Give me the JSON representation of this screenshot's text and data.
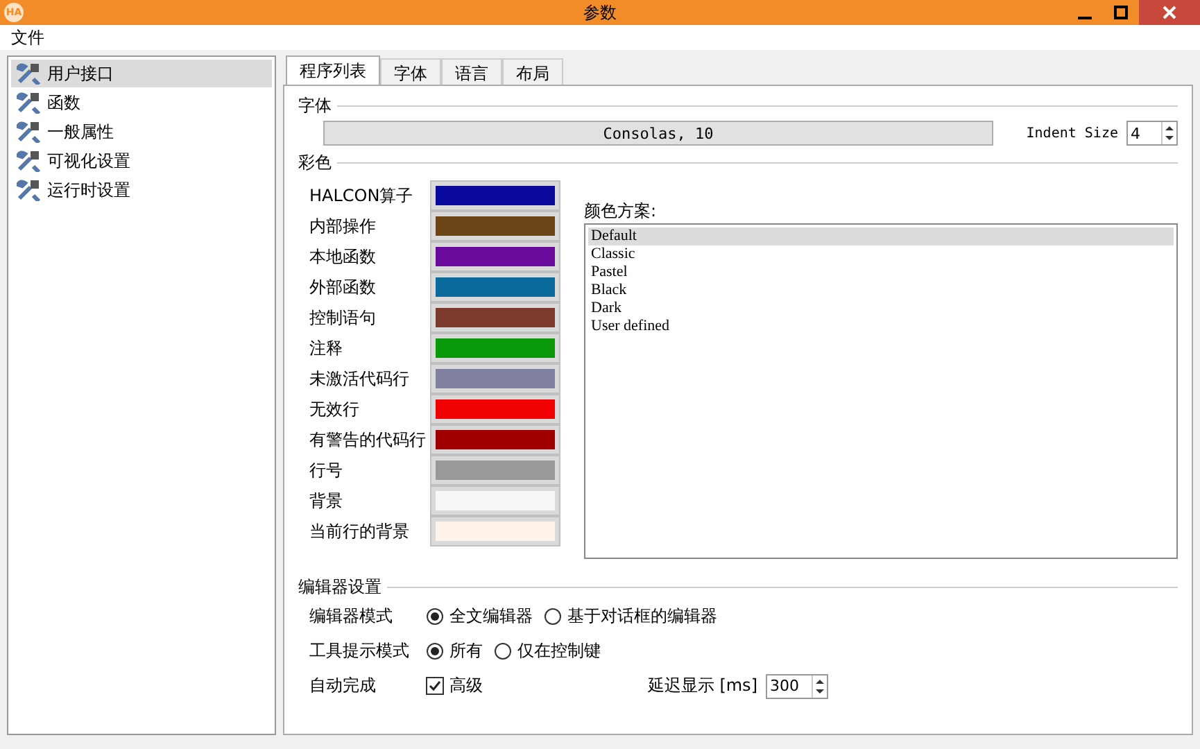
{
  "window": {
    "app_icon_text": "HA",
    "title": "参数"
  },
  "menu": [
    "文件"
  ],
  "sidebar": {
    "items": [
      {
        "label": "用户接口",
        "selected": true
      },
      {
        "label": "函数",
        "selected": false
      },
      {
        "label": "一般属性",
        "selected": false
      },
      {
        "label": "可视化设置",
        "selected": false
      },
      {
        "label": "运行时设置",
        "selected": false
      }
    ]
  },
  "tabs": [
    {
      "label": "程序列表",
      "selected": true
    },
    {
      "label": "字体",
      "selected": false
    },
    {
      "label": "语言",
      "selected": false
    },
    {
      "label": "布局",
      "selected": false
    }
  ],
  "font_section": {
    "heading": "字体",
    "font_button": "Consolas, 10",
    "indent_label": "Indent Size",
    "indent_value": "4"
  },
  "color_section": {
    "heading": "彩色",
    "colors": [
      {
        "label": "HALCON算子",
        "color": "#0a0a9c"
      },
      {
        "label": "内部操作",
        "color": "#6b4516"
      },
      {
        "label": "本地函数",
        "color": "#6a0a9c"
      },
      {
        "label": "外部函数",
        "color": "#0a6a9c"
      },
      {
        "label": "控制语句",
        "color": "#7b3a2a"
      },
      {
        "label": "注释",
        "color": "#0a990a"
      },
      {
        "label": "未激活代码行",
        "color": "#8080a0"
      },
      {
        "label": "无效行",
        "color": "#f00000"
      },
      {
        "label": "有警告的代码行",
        "color": "#a00000"
      },
      {
        "label": "行号",
        "color": "#999999"
      },
      {
        "label": "背景",
        "color": "#f8f8f8"
      },
      {
        "label": "当前行的背景",
        "color": "#fdf3ea"
      }
    ],
    "scheme_label": "颜色方案:",
    "schemes": [
      {
        "label": "Default",
        "selected": true
      },
      {
        "label": "Classic",
        "selected": false
      },
      {
        "label": "Pastel",
        "selected": false
      },
      {
        "label": "Black",
        "selected": false
      },
      {
        "label": "Dark",
        "selected": false
      },
      {
        "label": "User defined",
        "selected": false
      }
    ]
  },
  "editor_section": {
    "heading": "编辑器设置",
    "rows": [
      {
        "kind": "radio",
        "label": "编辑器模式",
        "options": [
          {
            "label": "全文编辑器",
            "selected": true
          },
          {
            "label": "基于对话框的编辑器",
            "selected": false
          }
        ]
      },
      {
        "kind": "radio",
        "label": "工具提示模式",
        "options": [
          {
            "label": "所有",
            "selected": true
          },
          {
            "label": "仅在控制键",
            "selected": false
          }
        ]
      },
      {
        "kind": "check",
        "label": "自动完成",
        "check_label": "高级",
        "checked": true,
        "delay_label": "延迟显示 [ms]",
        "delay_value": "300"
      }
    ]
  }
}
